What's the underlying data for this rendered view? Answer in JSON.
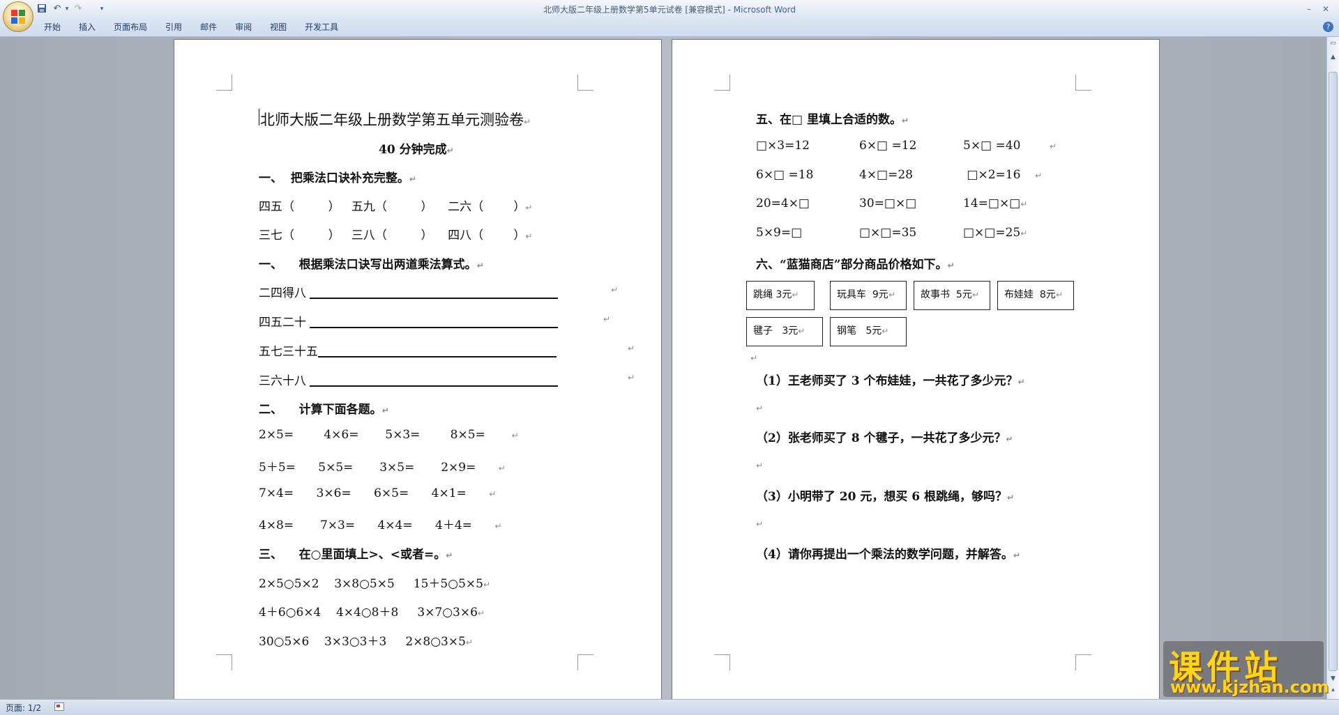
{
  "window": {
    "doc_title": "北师大版二年级上册数学第5单元试卷 [兼容模式] - ",
    "app_name": "Microsoft Word"
  },
  "quick_access": {
    "save_icon": "save-icon",
    "undo_icon": "undo-icon",
    "redo_icon": "redo-icon",
    "customize_icon": "dropdown-icon"
  },
  "ribbon": {
    "tabs": [
      "开始",
      "插入",
      "页面布局",
      "引用",
      "邮件",
      "审阅",
      "视图",
      "开发工具"
    ],
    "help_label": "?"
  },
  "left_page": {
    "title": "北师大版二年级上册数学第五单元测验卷",
    "subtitle": "40 分钟完成",
    "sec1_heading": "一、  把乘法口诀补充完整。",
    "sec1_row1": "四五（         ）   五九（         ）    二六（        ）",
    "sec1_row2": "三七（         ）   三八（         ）    四八（        ）",
    "sec2_heading": "一、    根据乘法口诀写出两道乘法算式。",
    "sec2_items": [
      "二四得八",
      "四五二十",
      "五七三十五",
      "三六十八"
    ],
    "sec3_heading": "二、    计算下面各题。",
    "sec3_rows": [
      "2×5=        4×6=       5×3=        8×5=",
      "5＋5=      5×5=       3×5=       2×9=",
      "7×4=      3×6=      6×5=      4×1=",
      "4×8=       7×3=      4×4=      4＋4="
    ],
    "sec4_heading": "三、    在○里面填上>、<或者=。",
    "sec4_rows": [
      "2×5○5×2    3×8○5×5     15＋5○5×5",
      "4＋6○6×4    4×4○8＋8     3×7○3×6",
      "30○5×6    3×3○3＋3     2×8○3×5"
    ]
  },
  "right_page": {
    "sec5_heading": "五、在□ 里填上合适的数。",
    "sec5_rows": [
      [
        "□×3=12",
        "6×□ =12",
        "5×□ =40"
      ],
      [
        "6×□ =18",
        "4×□=28",
        " □×2=16"
      ],
      [
        "20=4×□",
        "30=□×□",
        "14=□×□"
      ],
      [
        "5×9=□",
        "□×□=35",
        "□×□=25"
      ]
    ],
    "sec6_heading": "六、“蓝猫商店”部分商品价格如下。",
    "prices": [
      "跳绳 3元",
      "玩具车  9元",
      "故事书  5元",
      "布娃娃  8元",
      "毽子   3元",
      "钢笔   5元"
    ],
    "questions": [
      "（1）王老师买了 3 个布娃娃，一共花了多少元？",
      "（2）张老师买了 8 个毽子，一共花了多少元？",
      "（3）小明带了 20 元，想买 6 根跳绳，够吗？",
      "（4）请你再提出一个乘法的数学问题，并解答。"
    ]
  },
  "paragraph_mark": "↵",
  "status": {
    "page_label": "页面: 1/2"
  },
  "watermark": {
    "cn": "课件站",
    "url": "www.kjzhan.com"
  }
}
